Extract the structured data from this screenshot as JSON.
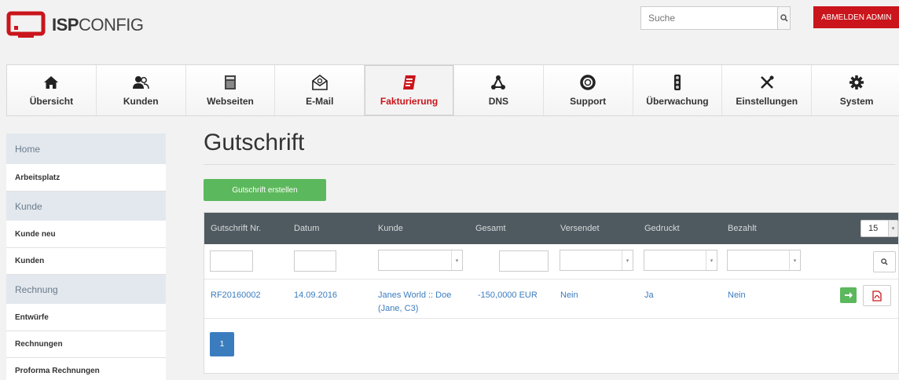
{
  "brand": {
    "name_bold": "ISP",
    "name_rest": "CONFIG"
  },
  "search": {
    "placeholder": "Suche"
  },
  "header": {
    "logout_label": "ABMELDEN ADMIN"
  },
  "nav": [
    {
      "label": "Übersicht",
      "icon": "home-icon"
    },
    {
      "label": "Kunden",
      "icon": "users-icon"
    },
    {
      "label": "Webseiten",
      "icon": "webpage-icon"
    },
    {
      "label": "E-Mail",
      "icon": "mail-icon"
    },
    {
      "label": "Fakturierung",
      "icon": "invoice-icon",
      "active": true
    },
    {
      "label": "DNS",
      "icon": "dns-icon"
    },
    {
      "label": "Support",
      "icon": "support-icon"
    },
    {
      "label": "Überwachung",
      "icon": "monitor-icon"
    },
    {
      "label": "Einstellungen",
      "icon": "tools-icon"
    },
    {
      "label": "System",
      "icon": "gear-icon"
    }
  ],
  "sidebar": {
    "home_head": "Home",
    "arbeitsplatz": "Arbeitsplatz",
    "kunde_head": "Kunde",
    "kunde_neu": "Kunde neu",
    "kunden": "Kunden",
    "rechnung_head": "Rechnung",
    "entwuerfe": "Entwürfe",
    "rechnungen": "Rechnungen",
    "proforma": "Proforma Rechnungen"
  },
  "main": {
    "title": "Gutschrift",
    "create_button": "Gutschrift erstellen",
    "per_page": "15",
    "pager_current": "1"
  },
  "table": {
    "headers": [
      "Gutschrift Nr.",
      "Datum",
      "Kunde",
      "Gesamt",
      "Versendet",
      "Gedruckt",
      "Bezahlt"
    ],
    "rows": [
      {
        "nr": "RF20160002",
        "datum": "14.09.2016",
        "kunde_line1": "Janes World :: Doe",
        "kunde_line2": "(Jane, C3)",
        "gesamt": "-150,0000 EUR",
        "versendet": "Nein",
        "gedruckt": "Ja",
        "bezahlt": "Nein"
      }
    ]
  },
  "colors": {
    "accent_red": "#c9151b",
    "success_green": "#5cb85c",
    "link_blue": "#3b7cbf",
    "table_head": "#4f5a60"
  }
}
